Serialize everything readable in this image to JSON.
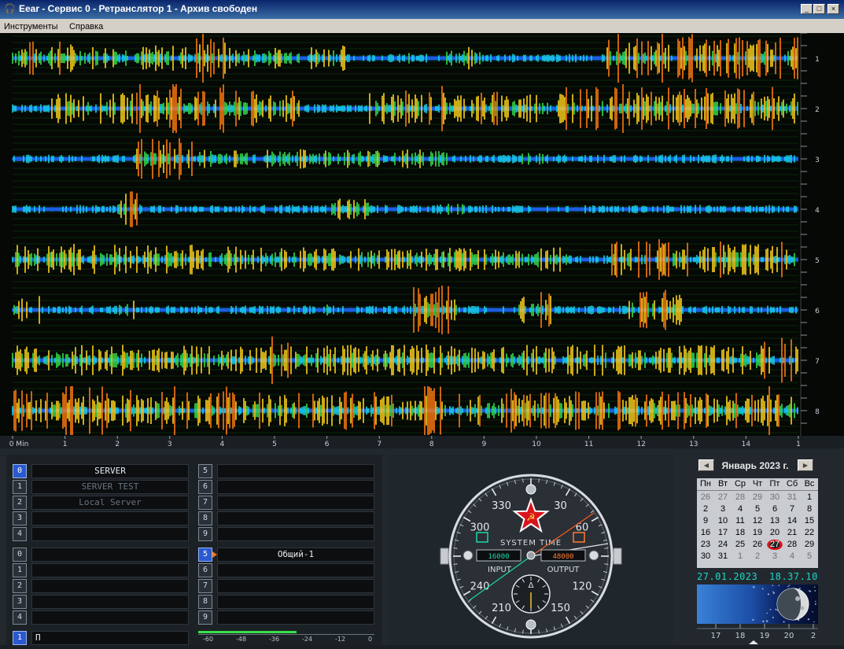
{
  "window": {
    "title": "Eear - Сервис 0 - Ретранслятор 1 - Архив свободен",
    "icon": "headphones-icon",
    "controls": [
      "minimize",
      "maximize",
      "close"
    ]
  },
  "menu": {
    "items": [
      "Инструменты",
      "Справка"
    ]
  },
  "waveform": {
    "channel_labels": [
      "1",
      "2",
      "3",
      "4",
      "5",
      "6",
      "7",
      "8"
    ],
    "time_axis_labels": [
      "0 Min",
      "1",
      "2",
      "3",
      "4",
      "5",
      "6",
      "7",
      "8",
      "9",
      "10",
      "11",
      "12",
      "13",
      "14",
      "1"
    ],
    "colors": {
      "quiet": "#1a5fe0",
      "low": "#19d0e6",
      "mid": "#33e04a",
      "high": "#ffd21a",
      "peak": "#ff7a10",
      "grid": "#0f4a0f"
    }
  },
  "channels": {
    "group_a_left": [
      {
        "num": "0",
        "name": "SERVER",
        "active": true
      },
      {
        "num": "1",
        "name": "SERVER TEST",
        "active": false
      },
      {
        "num": "2",
        "name": "Local Server",
        "active": false
      },
      {
        "num": "3",
        "name": "",
        "active": false
      },
      {
        "num": "4",
        "name": "",
        "active": false
      }
    ],
    "group_a_right": [
      {
        "num": "5",
        "name": ""
      },
      {
        "num": "6",
        "name": ""
      },
      {
        "num": "7",
        "name": ""
      },
      {
        "num": "8",
        "name": ""
      },
      {
        "num": "9",
        "name": ""
      }
    ],
    "group_b_left": [
      {
        "num": "0",
        "name": ""
      },
      {
        "num": "1",
        "name": ""
      },
      {
        "num": "2",
        "name": ""
      },
      {
        "num": "3",
        "name": ""
      },
      {
        "num": "4",
        "name": ""
      }
    ],
    "group_b_right": [
      {
        "num": "5",
        "name": "Общий-1",
        "active": true
      },
      {
        "num": "6",
        "name": ""
      },
      {
        "num": "7",
        "name": ""
      },
      {
        "num": "8",
        "name": ""
      },
      {
        "num": "9",
        "name": ""
      }
    ],
    "bottom_row": {
      "num": "1",
      "name": "Π"
    },
    "meter_labels": [
      "-60",
      "-48",
      "-36",
      "-24",
      "-12",
      "0"
    ]
  },
  "clock": {
    "label": "SYSTEM TIME",
    "input_value": "16000",
    "output_value": "48000",
    "input_label": "INPUT",
    "output_label": "OUTPUT",
    "dial_numbers": [
      "330",
      "30",
      "60",
      "120",
      "150",
      "210",
      "240",
      "300"
    ],
    "compass_letter": "Δ",
    "emblem": "red-star-hammer-sickle-icon"
  },
  "calendar": {
    "month_label": "Январь 2023 г.",
    "weekdays": [
      "Пн",
      "Вт",
      "Ср",
      "Чт",
      "Пт",
      "Сб",
      "Вс"
    ],
    "weeks": [
      [
        "26",
        "27",
        "28",
        "29",
        "30",
        "31",
        "1"
      ],
      [
        "2",
        "3",
        "4",
        "5",
        "6",
        "7",
        "8"
      ],
      [
        "9",
        "10",
        "11",
        "12",
        "13",
        "14",
        "15"
      ],
      [
        "16",
        "17",
        "18",
        "19",
        "20",
        "21",
        "22"
      ],
      [
        "23",
        "24",
        "25",
        "26",
        "27",
        "28",
        "29"
      ],
      [
        "30",
        "31",
        "1",
        "2",
        "3",
        "4",
        "5"
      ]
    ],
    "today": "27",
    "date": "27.01.2023",
    "time": "18.37.10",
    "moon_axis_labels": [
      "17",
      "18",
      "19",
      "20",
      "2"
    ]
  }
}
